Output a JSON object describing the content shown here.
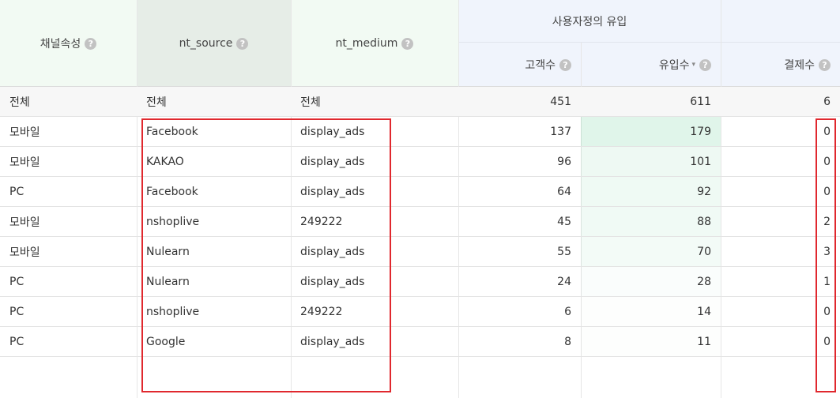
{
  "header": {
    "channel": "채널속성",
    "source": "nt_source",
    "medium": "nt_medium",
    "group": "사용자정의 유입",
    "customers": "고객수",
    "visits": "유입수",
    "payments": "결제수",
    "help": "?",
    "sort": "▾"
  },
  "total": {
    "channel": "전체",
    "source": "전체",
    "medium": "전체",
    "customers": "451",
    "visits": "611",
    "payments": "6"
  },
  "rows": [
    {
      "channel": "모바일",
      "source": "Facebook",
      "medium": "display_ads",
      "customers": "137",
      "visits": "179",
      "payments": "0"
    },
    {
      "channel": "모바일",
      "source": "KAKAO",
      "medium": "display_ads",
      "customers": "96",
      "visits": "101",
      "payments": "0"
    },
    {
      "channel": "PC",
      "source": "Facebook",
      "medium": "display_ads",
      "customers": "64",
      "visits": "92",
      "payments": "0"
    },
    {
      "channel": "모바일",
      "source": "nshoplive",
      "medium": "249222",
      "customers": "45",
      "visits": "88",
      "payments": "2"
    },
    {
      "channel": "모바일",
      "source": "Nulearn",
      "medium": "display_ads",
      "customers": "55",
      "visits": "70",
      "payments": "3"
    },
    {
      "channel": "PC",
      "source": "Nulearn",
      "medium": "display_ads",
      "customers": "24",
      "visits": "28",
      "payments": "1"
    },
    {
      "channel": "PC",
      "source": "nshoplive",
      "medium": "249222",
      "customers": "6",
      "visits": "14",
      "payments": "0"
    },
    {
      "channel": "PC",
      "source": "Google",
      "medium": "display_ads",
      "customers": "8",
      "visits": "11",
      "payments": "0"
    }
  ],
  "colors": {
    "header_channel_bg": "#f2faf3",
    "header_source_bg": "#e6ede7",
    "header_medium_bg": "#f2faf3",
    "header_group_bg": "#f0f4fc",
    "total_row_bg": "#f7f7f7",
    "visits_heat": "#3dbf7a",
    "highlight": "#e0282e"
  }
}
